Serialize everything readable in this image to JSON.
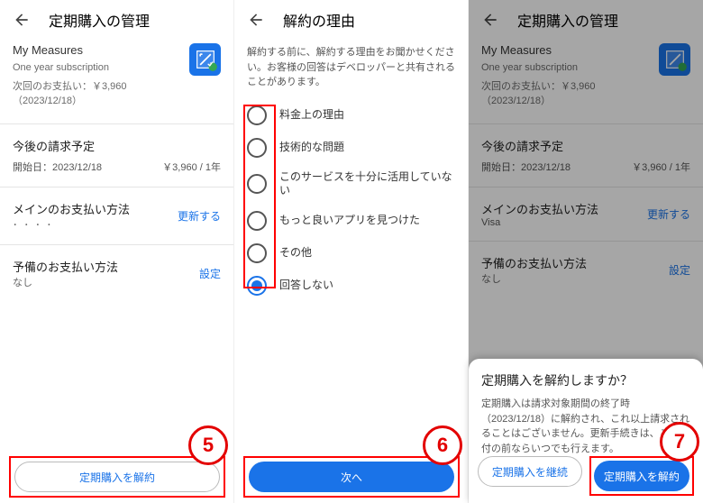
{
  "pane1": {
    "title": "定期購入の管理",
    "app_name": "My Measures",
    "sub_line": "One year subscription",
    "next_pay": "次回のお支払い：￥3,960（2023/12/18）",
    "section_schedule": "今後の請求予定",
    "sched_start": "開始日：2023/12/18",
    "sched_price": "￥3,960 / 1年",
    "section_pay_main": "メインのお支払い方法",
    "pay_main_sub": "",
    "update": "更新する",
    "section_pay_backup": "予備のお支払い方法",
    "backup_sub": "なし",
    "set": "設定",
    "cancel_btn": "定期購入を解約"
  },
  "pane2": {
    "title": "解約の理由",
    "desc": "解約する前に、解約する理由をお聞かせください。お客様の回答はデベロッパーと共有されることがあります。",
    "options": {
      "o1": "料金上の理由",
      "o2": "技術的な問題",
      "o3": "このサービスを十分に活用していない",
      "o4": "もっと良いアプリを見つけた",
      "o5": "その他",
      "o6": "回答しない"
    },
    "next": "次へ"
  },
  "pane3": {
    "title": "定期購入の管理",
    "app_name": "My Measures",
    "sub_line": "One year subscription",
    "next_pay": "次回のお支払い：￥3,960（2023/12/18）",
    "section_schedule": "今後の請求予定",
    "sched_start": "開始日：2023/12/18",
    "sched_price": "￥3,960 / 1年",
    "section_pay_main": "メインのお支払い方法",
    "pay_main_sub": "Visa",
    "update": "更新する",
    "section_pay_backup": "予備のお支払い方法",
    "backup_sub": "なし",
    "set": "設定",
    "sheet_title": "定期購入を解約しますか？",
    "sheet_desc": "定期購入は請求対象期間の終了時（2023/12/18）に解約され、これ以上請求されることはございません。更新手続きは、この日付の前ならいつでも行えます。",
    "continue_btn": "定期購入を継続",
    "cancel_btn": "定期購入を解約"
  },
  "steps": {
    "s5": "5",
    "s6": "6",
    "s7": "7"
  }
}
